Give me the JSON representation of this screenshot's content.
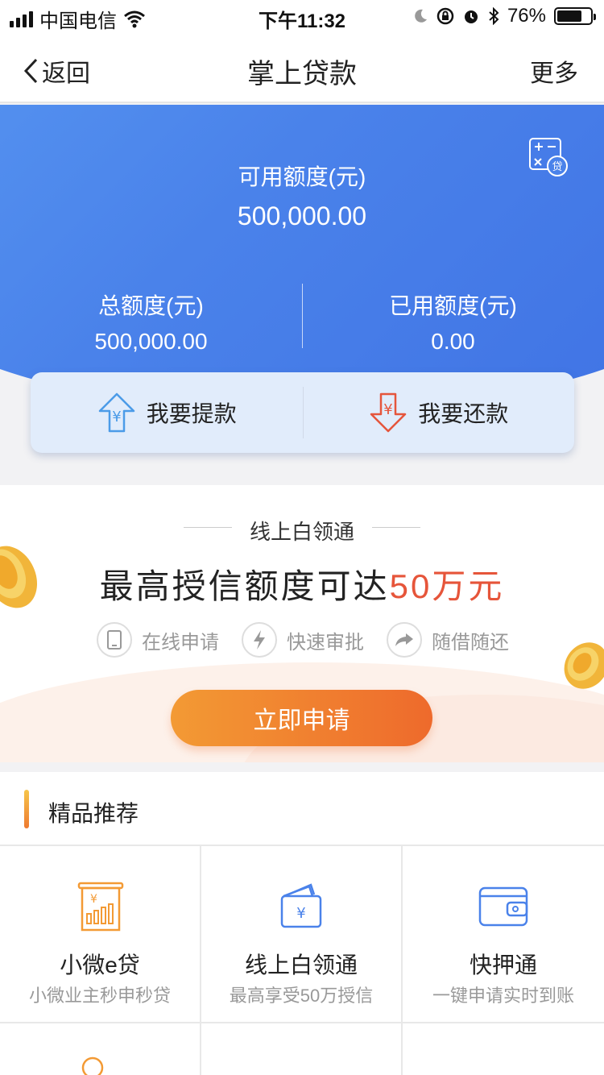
{
  "status_bar": {
    "carrier": "中国电信",
    "time": "下午11:32",
    "battery": "76%",
    "battery_level": 0.76
  },
  "nav": {
    "back_label": "返回",
    "title": "掌上贷款",
    "more_label": "更多"
  },
  "hero": {
    "available_label": "可用额度(元)",
    "available_value": "500,000.00",
    "total_label": "总额度(元)",
    "total_value": "500,000.00",
    "used_label": "已用额度(元)",
    "used_value": "0.00",
    "calc_icon_text": "贷",
    "withdraw_label": "我要提款",
    "repay_label": "我要还款",
    "currency_symbol": "¥"
  },
  "promo": {
    "kicker": "线上白领通",
    "headline_main": "最高授信额度可达",
    "headline_highlight": "50万元",
    "features": [
      {
        "label": "在线申请",
        "icon": "phone-icon"
      },
      {
        "label": "快速审批",
        "icon": "lightning-icon"
      },
      {
        "label": "随借随还",
        "icon": "arrow-icon"
      }
    ],
    "apply_label": "立即申请"
  },
  "recommend": {
    "title": "精品推荐",
    "items": [
      {
        "name": "小微e贷",
        "desc": "小微业主秒申秒贷",
        "icon": "receipt-chart-icon"
      },
      {
        "name": "线上白领通",
        "desc": "最高享受50万授信",
        "icon": "yuan-wallet-icon"
      },
      {
        "name": "快押通",
        "desc": "一键申请实时到账",
        "icon": "wallet-icon"
      }
    ]
  },
  "colors": {
    "brand_blue": "#4a82ea",
    "accent_orange": "#ee6a2c",
    "highlight_red": "#e6553a"
  }
}
